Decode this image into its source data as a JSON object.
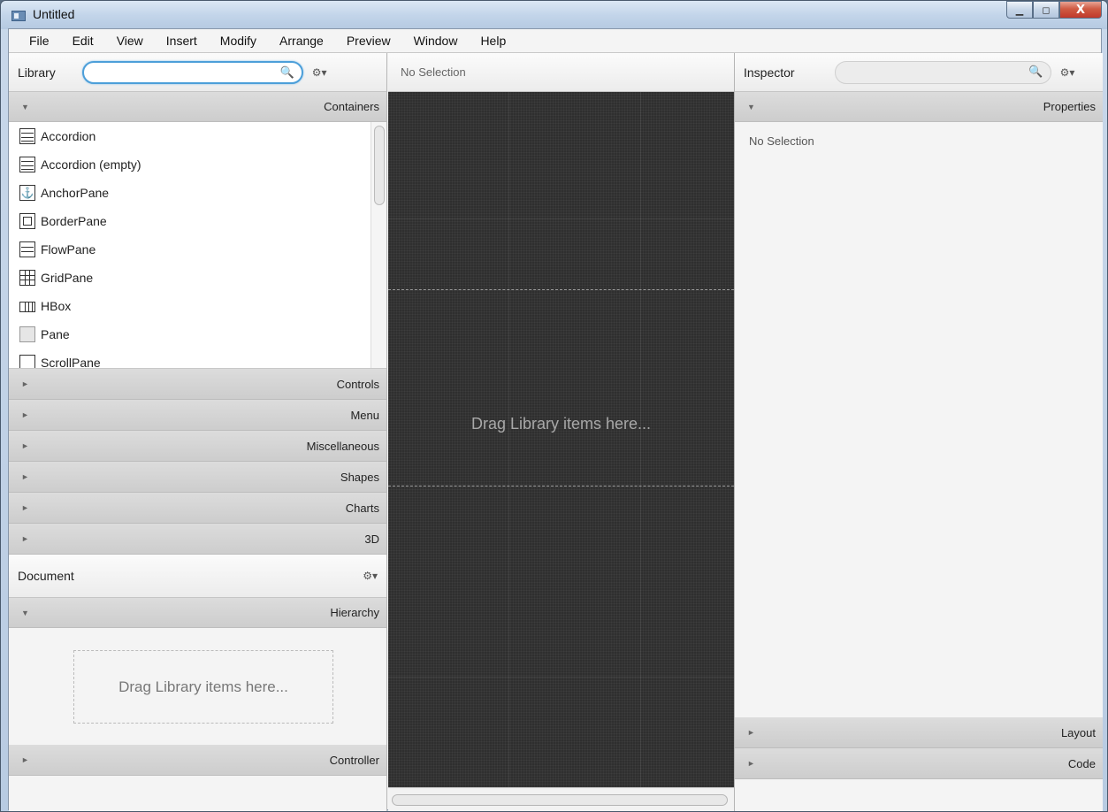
{
  "window": {
    "title": "Untitled",
    "minimize": "▁",
    "maximize": "◻",
    "close": "X"
  },
  "menu": [
    "File",
    "Edit",
    "View",
    "Insert",
    "Modify",
    "Arrange",
    "Preview",
    "Window",
    "Help"
  ],
  "library": {
    "title": "Library",
    "search_value": "",
    "search_icon": "search-icon",
    "gear": "⚙▾",
    "containers_label": "Containers",
    "items": [
      "Accordion",
      "Accordion  (empty)",
      "AnchorPane",
      "BorderPane",
      "FlowPane",
      "GridPane",
      "HBox",
      "Pane",
      "ScrollPane"
    ],
    "sections": [
      "Controls",
      "Menu",
      "Miscellaneous",
      "Shapes",
      "Charts",
      "3D"
    ]
  },
  "document": {
    "title": "Document",
    "gear": "⚙▾",
    "hierarchy_label": "Hierarchy",
    "drop_text": "Drag Library items here...",
    "controller_label": "Controller"
  },
  "center": {
    "selection": "No Selection",
    "drop_text": "Drag Library items here..."
  },
  "inspector": {
    "title": "Inspector",
    "search_value": "",
    "gear": "⚙▾",
    "properties_label": "Properties",
    "selection": "No Selection",
    "layout_label": "Layout",
    "code_label": "Code"
  },
  "glyphs": {
    "expanded": "▼",
    "collapsed": "►",
    "search": "🔍"
  },
  "colors": {
    "canvas": "#2f2f2f",
    "search_focus": "#4d9fd9",
    "close_button": "#c0392b"
  }
}
